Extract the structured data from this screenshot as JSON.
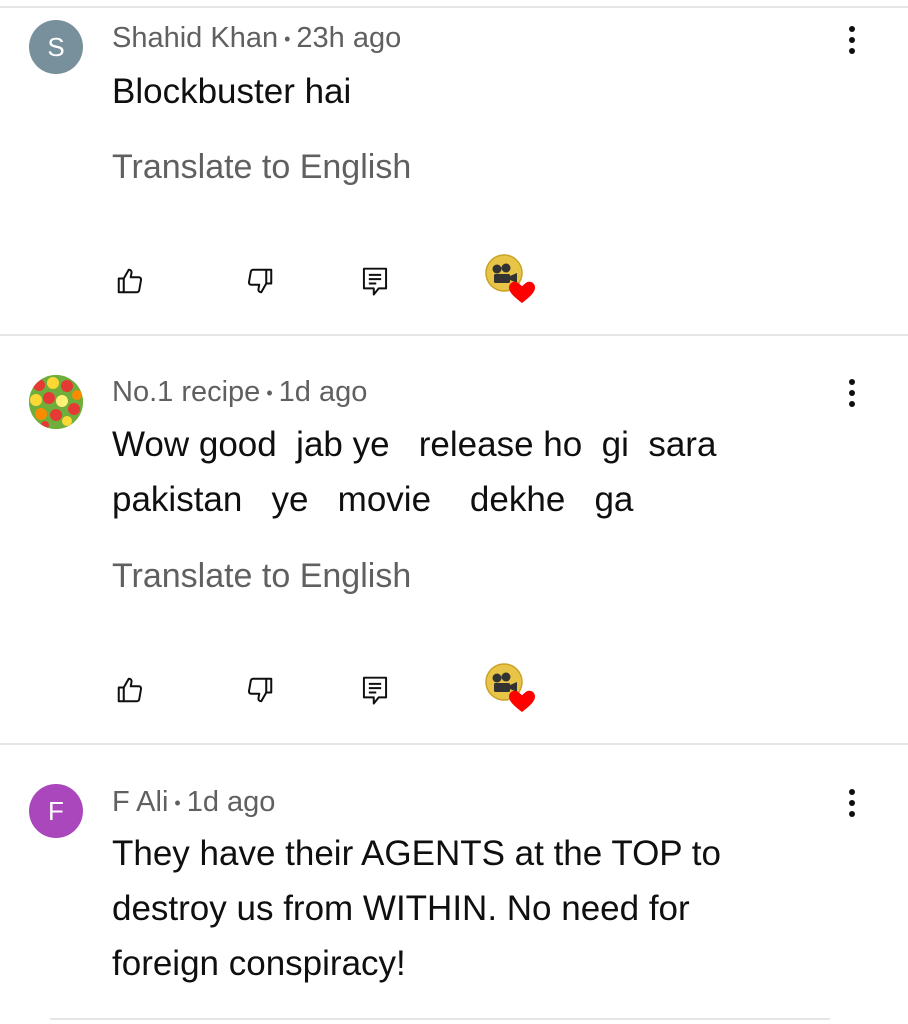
{
  "comments": [
    {
      "author": "Shahid Khan",
      "separator": "•",
      "time": "23h ago",
      "avatar_letter": "S",
      "avatar_color": "#78909c",
      "text": "Blockbuster hai",
      "translate_label": "Translate to English"
    },
    {
      "author": "No.1 recipe",
      "separator": "•",
      "time": "1d ago",
      "avatar_letter": "",
      "avatar_color": "#8bc34a",
      "text": "Wow good  jab ye   release ho  gi  sara\npakistan   ye   movie    dekhe   ga",
      "translate_label": "Translate to English"
    },
    {
      "author": "F Ali",
      "separator": "•",
      "time": "1d ago",
      "avatar_letter": "F",
      "avatar_color": "#ab47bc",
      "text": "They have their AGENTS at the TOP to\ndestroy us from WITHIN. No need for\nforeign conspiracy!",
      "translate_label": ""
    }
  ],
  "icons": {
    "like": "thumbs-up-icon",
    "dislike": "thumbs-down-icon",
    "reply": "reply-icon",
    "creator_heart": "creator-heart-icon",
    "more": "more-vert-icon"
  },
  "colors": {
    "meta_text": "#606060",
    "heart": "#ff0000",
    "divider": "#e5e5e5"
  }
}
